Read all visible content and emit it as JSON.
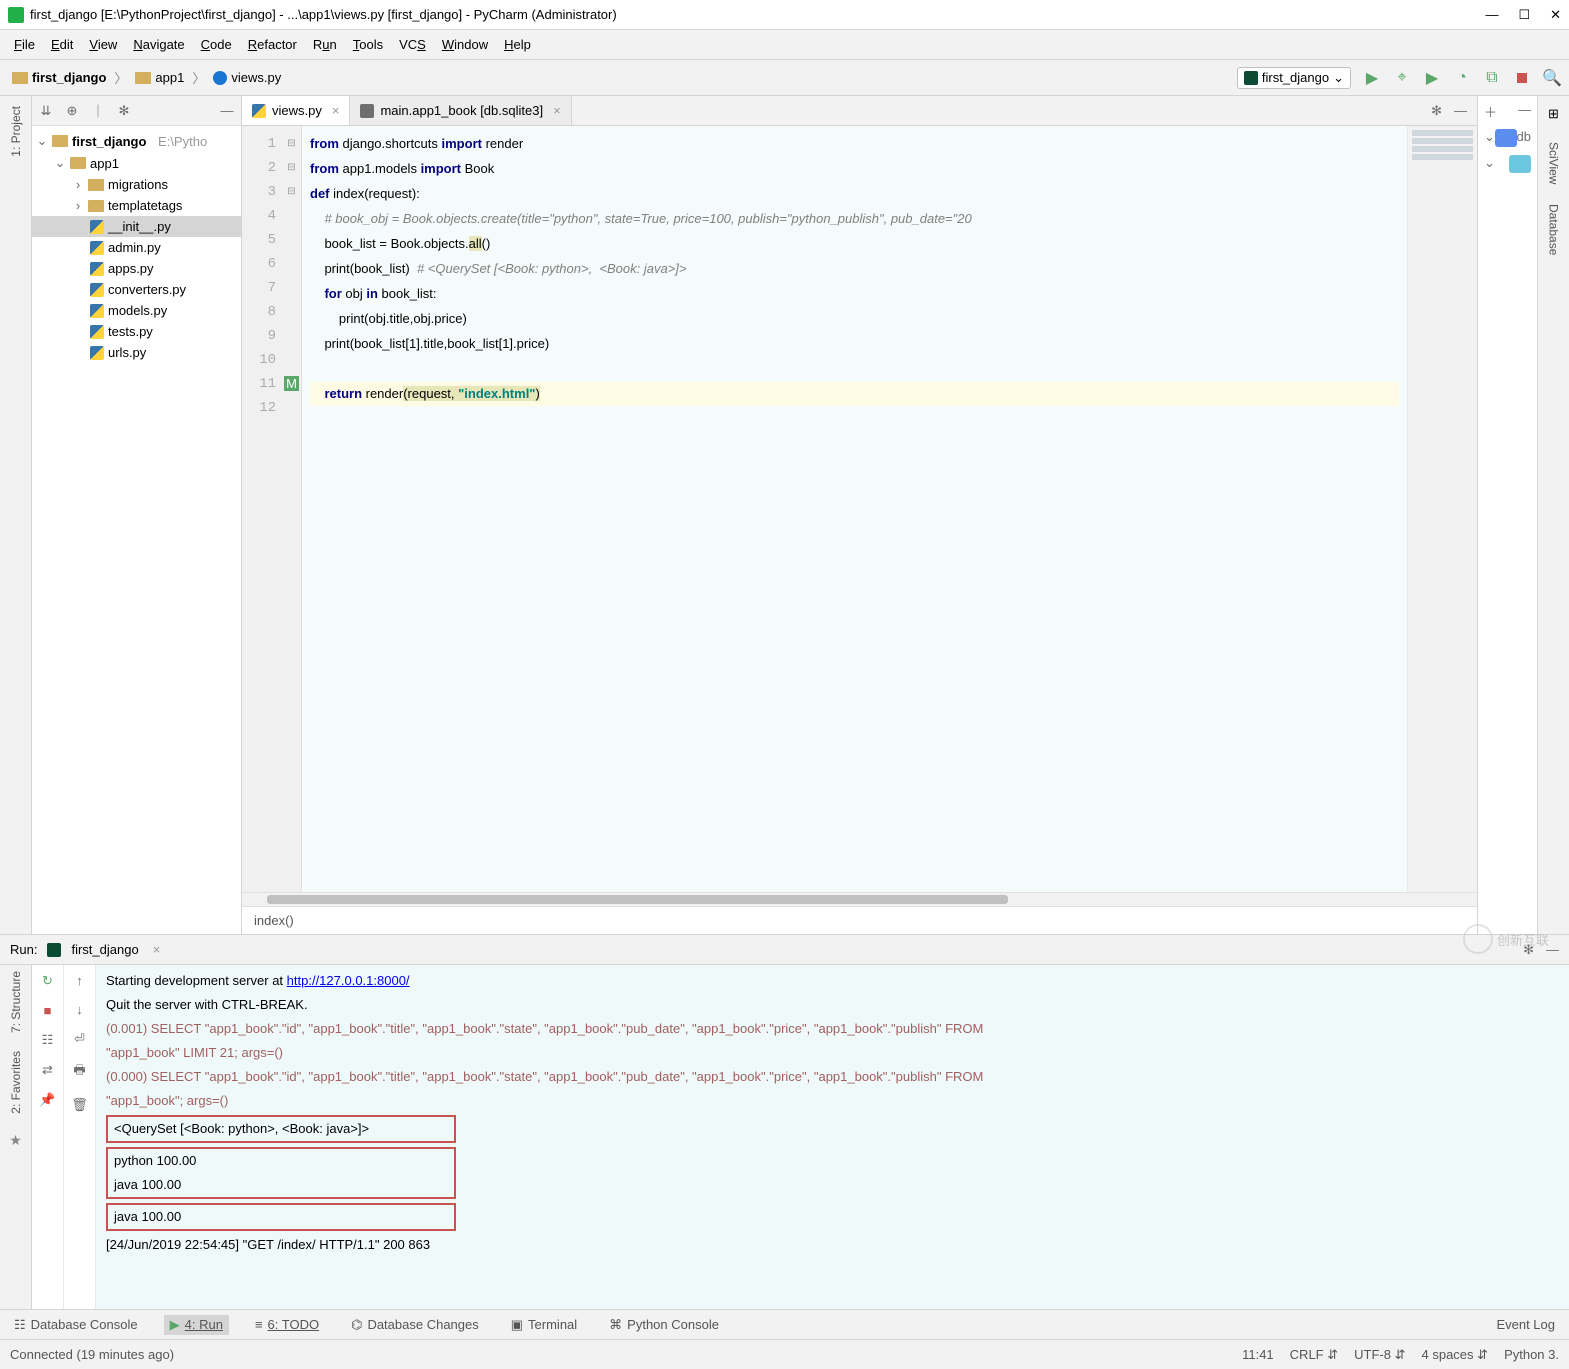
{
  "title": "first_django [E:\\PythonProject\\first_django] - ...\\app1\\views.py [first_django] - PyCharm (Administrator)",
  "menu": [
    "File",
    "Edit",
    "View",
    "Navigate",
    "Code",
    "Refactor",
    "Run",
    "Tools",
    "VCS",
    "Window",
    "Help"
  ],
  "breadcrumb": [
    "first_django",
    "app1",
    "views.py"
  ],
  "run_config": "first_django",
  "tabs": {
    "active": "views.py",
    "inactive": "main.app1_book [db.sqlite3]"
  },
  "tree": {
    "root": "first_django",
    "root_path": "E:\\Pytho",
    "app": "app1",
    "folders": [
      "migrations",
      "templatetags"
    ],
    "files": [
      "__init__.py",
      "admin.py",
      "apps.py",
      "converters.py",
      "models.py",
      "tests.py",
      "urls.py"
    ]
  },
  "code": {
    "l1": "from django.shortcuts import render",
    "l2": "from app1.models import Book",
    "l3": "def index(request):",
    "l4": "    # book_obj = Book.objects.create(title=\"python\", state=True, price=100, publish=\"python_publish\", pub_date=\"20",
    "l5a": "    book_list = Book.objects.",
    "l5b": "all",
    "l5c": "()",
    "l6a": "    print(book_list)  ",
    "l6b": "# <QuerySet [<Book: python>,  <Book: java>]>",
    "l7a": "    for obj in book_list:",
    "l8": "        print(obj.title,obj.price)",
    "l9": "    print(book_list[1].title,book_list[1].price)",
    "l10": "",
    "l11a": "    return render",
    "l11b": "(request, ",
    "l11c": "\"index.html\"",
    "l11d": ")",
    "breadcrumb": "index()"
  },
  "console": {
    "l1a": "Starting development server at ",
    "l1b": "http://127.0.0.1:8000/",
    "l2": "Quit the server with CTRL-BREAK.",
    "l3": "(0.001) SELECT \"app1_book\".\"id\",  \"app1_book\".\"title\",  \"app1_book\".\"state\",  \"app1_book\".\"pub_date\",  \"app1_book\".\"price\",  \"app1_book\".\"publish\" FROM ",
    "l4": "\"app1_book\"  LIMIT 21; args=()",
    "l5": "(0.000) SELECT \"app1_book\".\"id\",  \"app1_book\".\"title\",  \"app1_book\".\"state\",  \"app1_book\".\"pub_date\",  \"app1_book\".\"price\",  \"app1_book\".\"publish\" FROM ",
    "l6": "\"app1_book\"; args=()",
    "b1": "<QuerySet [<Book: python>, <Book: java>]>",
    "b2a": "python 100.00",
    "b2b": "java 100.00",
    "b3": "java 100.00",
    "l7": "[24/Jun/2019 22:54:45] \"GET /index/ HTTP/1.1\" 200 863"
  },
  "run_label": "Run:",
  "run_tab": "first_django",
  "bottom_tabs": {
    "db_console": "Database Console",
    "run": "4: Run",
    "todo": "6: TODO",
    "db_changes": "Database Changes",
    "terminal": "Terminal",
    "py_console": "Python Console",
    "event_log": "Event Log"
  },
  "status": {
    "left": "Connected (19 minutes ago)",
    "time": "11:41",
    "enc1": "CRLF",
    "enc2": "UTF-8",
    "indent": "4 spaces",
    "python": "Python 3."
  },
  "left_tabs": {
    "project": "1: Project",
    "structure": "7: Structure",
    "favorites": "2: Favorites"
  },
  "right_tabs": {
    "sciview": "SciView",
    "database": "Database",
    "db": "db"
  },
  "watermark": "创新互联"
}
